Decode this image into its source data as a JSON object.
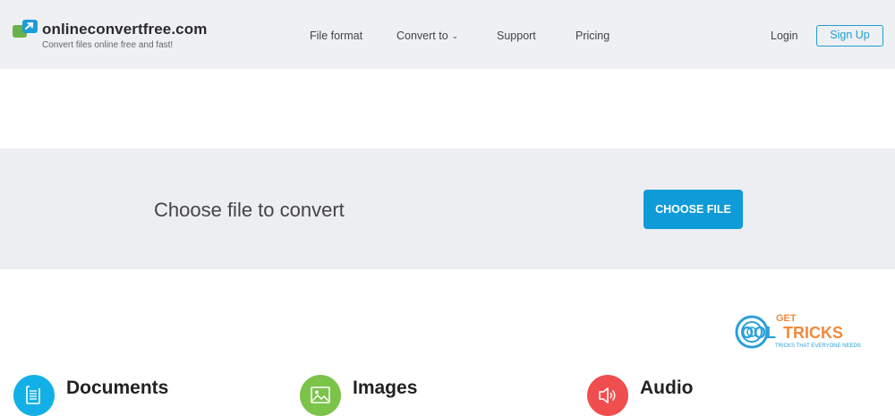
{
  "header": {
    "logo_title": "onlineconvertfree.com",
    "logo_tagline": "Convert files online free and fast!",
    "nav": {
      "file_format": "File format",
      "convert_to": "Convert to",
      "support": "Support",
      "pricing": "Pricing"
    },
    "login": "Login",
    "signup": "Sign Up"
  },
  "upload": {
    "label": "Choose file to convert",
    "button": "CHOOSE FILE"
  },
  "watermark": {
    "line1": "GET",
    "line2_a": "OOL",
    "line2_b": "TRICKS",
    "line3": "TRICKS THAT EVERYONE NEEDS"
  },
  "categories": [
    {
      "label": "Documents",
      "icon": "document-icon",
      "color": "#12b0e6"
    },
    {
      "label": "Images",
      "icon": "image-icon",
      "color": "#7cc34a"
    },
    {
      "label": "Audio",
      "icon": "speaker-icon",
      "color": "#f04e4e"
    }
  ],
  "colors": {
    "accent": "#0f9bd7",
    "header_bg": "#eef0f3",
    "band_bg": "#eceef1"
  }
}
